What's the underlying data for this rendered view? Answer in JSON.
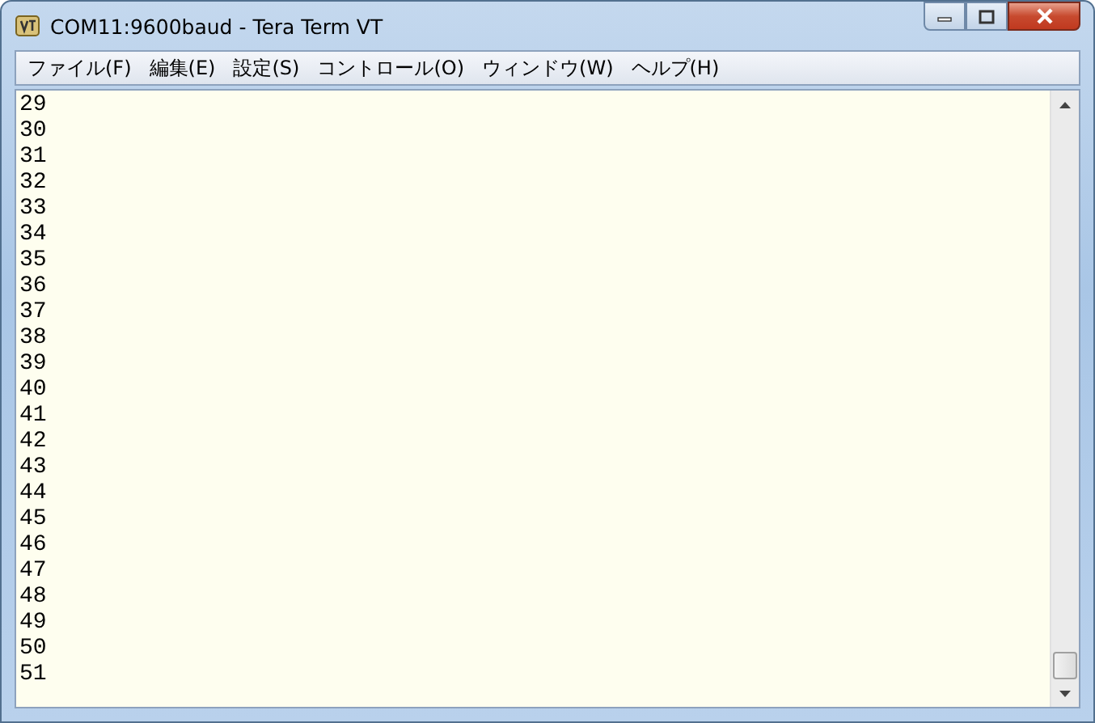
{
  "window": {
    "title": "COM11:9600baud - Tera Term VT"
  },
  "menu": [
    {
      "label": "ファイル(F)"
    },
    {
      "label": "編集(E)"
    },
    {
      "label": "設定(S)"
    },
    {
      "label": "コントロール(O)"
    },
    {
      "label": "ウィンドウ(W)"
    },
    {
      "label": "ヘルプ(H)"
    }
  ],
  "terminal": {
    "lines": [
      "29",
      "30",
      "31",
      "32",
      "33",
      "34",
      "35",
      "36",
      "37",
      "38",
      "39",
      "40",
      "41",
      "42",
      "43",
      "44",
      "45",
      "46",
      "47",
      "48",
      "49",
      "50",
      "51"
    ]
  }
}
